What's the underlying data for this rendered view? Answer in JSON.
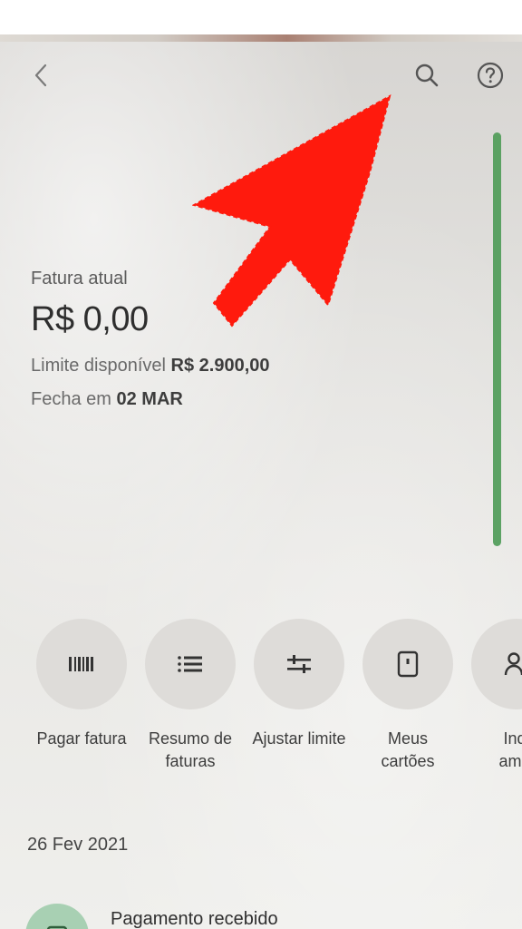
{
  "header": {
    "back_icon": "chevron-left-icon",
    "search_icon": "search-icon",
    "help_icon": "help-circle-icon"
  },
  "invoice": {
    "label": "Fatura atual",
    "amount": "R$ 0,00",
    "limit_label": "Limite disponível",
    "limit_value": "R$ 2.900,00",
    "close_label": "Fecha em",
    "close_value": "02 MAR"
  },
  "overlay": {
    "arrow_color": "#ff1a0d"
  },
  "actions": [
    {
      "label": "Pagar fatura",
      "icon": "barcode-icon"
    },
    {
      "label": "Resumo de\nfaturas",
      "icon": "list-icon"
    },
    {
      "label": "Ajustar limite",
      "icon": "sliders-icon"
    },
    {
      "label": "Meus\ncartões",
      "icon": "card-icon"
    },
    {
      "label": "Indi\namig",
      "icon": "person-add-icon"
    }
  ],
  "feed": {
    "date": "26 Fev 2021",
    "items": [
      {
        "title": "Pagamento recebido",
        "icon": "payment-icon"
      }
    ]
  },
  "colors": {
    "accent_green": "#4d9a55",
    "arrow_red": "#ff1a0d"
  }
}
